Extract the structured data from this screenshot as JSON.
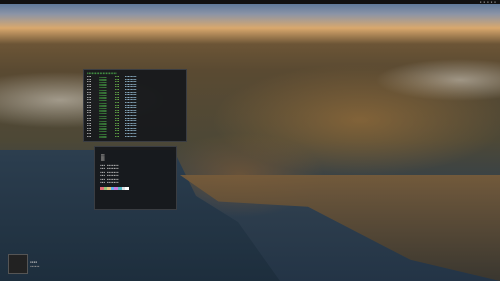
{
  "desktop": {
    "wallpaper": "big-sur-coast",
    "accent": "#4fb84f"
  },
  "htop": {
    "rows": 24
  },
  "neofetch": {
    "lines": 6,
    "swatch_colors": [
      "#e06c75",
      "#98c379",
      "#e5c07b",
      "#61afef",
      "#c678dd",
      "#56b6c2",
      "#dcdfe4",
      "#ffffff"
    ]
  }
}
